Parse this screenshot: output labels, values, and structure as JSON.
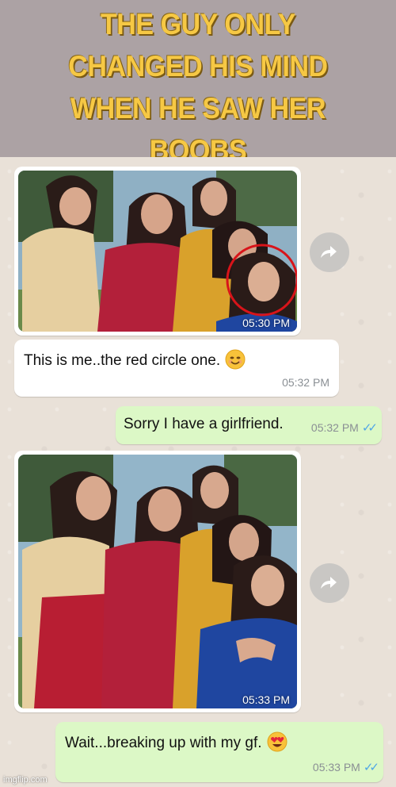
{
  "meme": {
    "caption_lines": [
      "THE GUY ONLY",
      "CHANGED HIS MIND",
      "WHEN HE SAW HER BOOBS"
    ]
  },
  "chat": {
    "messages": [
      {
        "type": "photo",
        "direction": "incoming",
        "time": "05:30 PM",
        "highlight": "red-circle"
      },
      {
        "type": "text",
        "direction": "incoming",
        "text": "This is me..the red circle one.",
        "emoji": "smiling-face-icon",
        "time": "05:32 PM"
      },
      {
        "type": "text",
        "direction": "outgoing",
        "text": "Sorry I have a girlfriend.",
        "time": "05:32 PM",
        "status": "read"
      },
      {
        "type": "photo",
        "direction": "incoming",
        "time": "05:33 PM"
      },
      {
        "type": "text",
        "direction": "outgoing",
        "text": "Wait...breaking up with my gf.",
        "emoji": "heart-eyes-icon",
        "time": "05:33 PM",
        "status": "read"
      }
    ],
    "forward_icon": "forward-icon",
    "read_color": "#4fa6e6",
    "incoming_color": "#ffffff",
    "outgoing_color": "#dcf8c6"
  },
  "watermark": "imgflip.com"
}
